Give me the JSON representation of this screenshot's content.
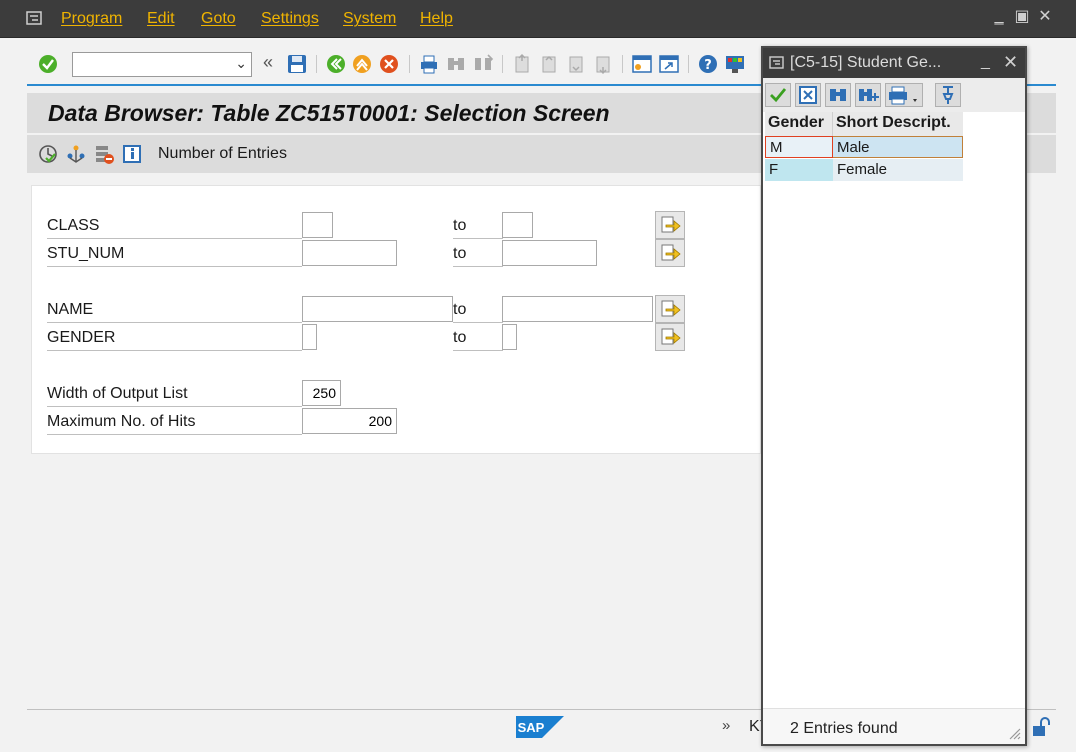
{
  "menu": {
    "items": [
      "Program",
      "Edit",
      "Goto",
      "Settings",
      "System",
      "Help"
    ]
  },
  "toolbar": {
    "command_value": "",
    "back_chevron": "«"
  },
  "screen": {
    "title": "Data Browser: Table ZC515T0001: Selection Screen",
    "app_button_label": "Number of Entries"
  },
  "fields": {
    "class_label": "CLASS",
    "stu_num_label": "STU_NUM",
    "name_label": "NAME",
    "gender_label": "GENDER",
    "to_label": "to",
    "width_label": "Width of Output List",
    "width_value": "250",
    "max_hits_label": "Maximum No. of Hits",
    "max_hits_value": "200"
  },
  "status": {
    "chevron": "»",
    "text": "KY"
  },
  "popup": {
    "title": "[C5-15] Student Ge...",
    "columns": [
      "Gender",
      "Short Descript."
    ],
    "rows": [
      {
        "code": "M",
        "desc": "Male"
      },
      {
        "code": "F",
        "desc": "Female"
      }
    ],
    "footer": "2 Entries found"
  },
  "colors": {
    "menu_text": "#f0b400",
    "accent_blue": "#2a8ad0",
    "selected_row": "#cde4f2",
    "key_col": "#bfe6ef"
  }
}
